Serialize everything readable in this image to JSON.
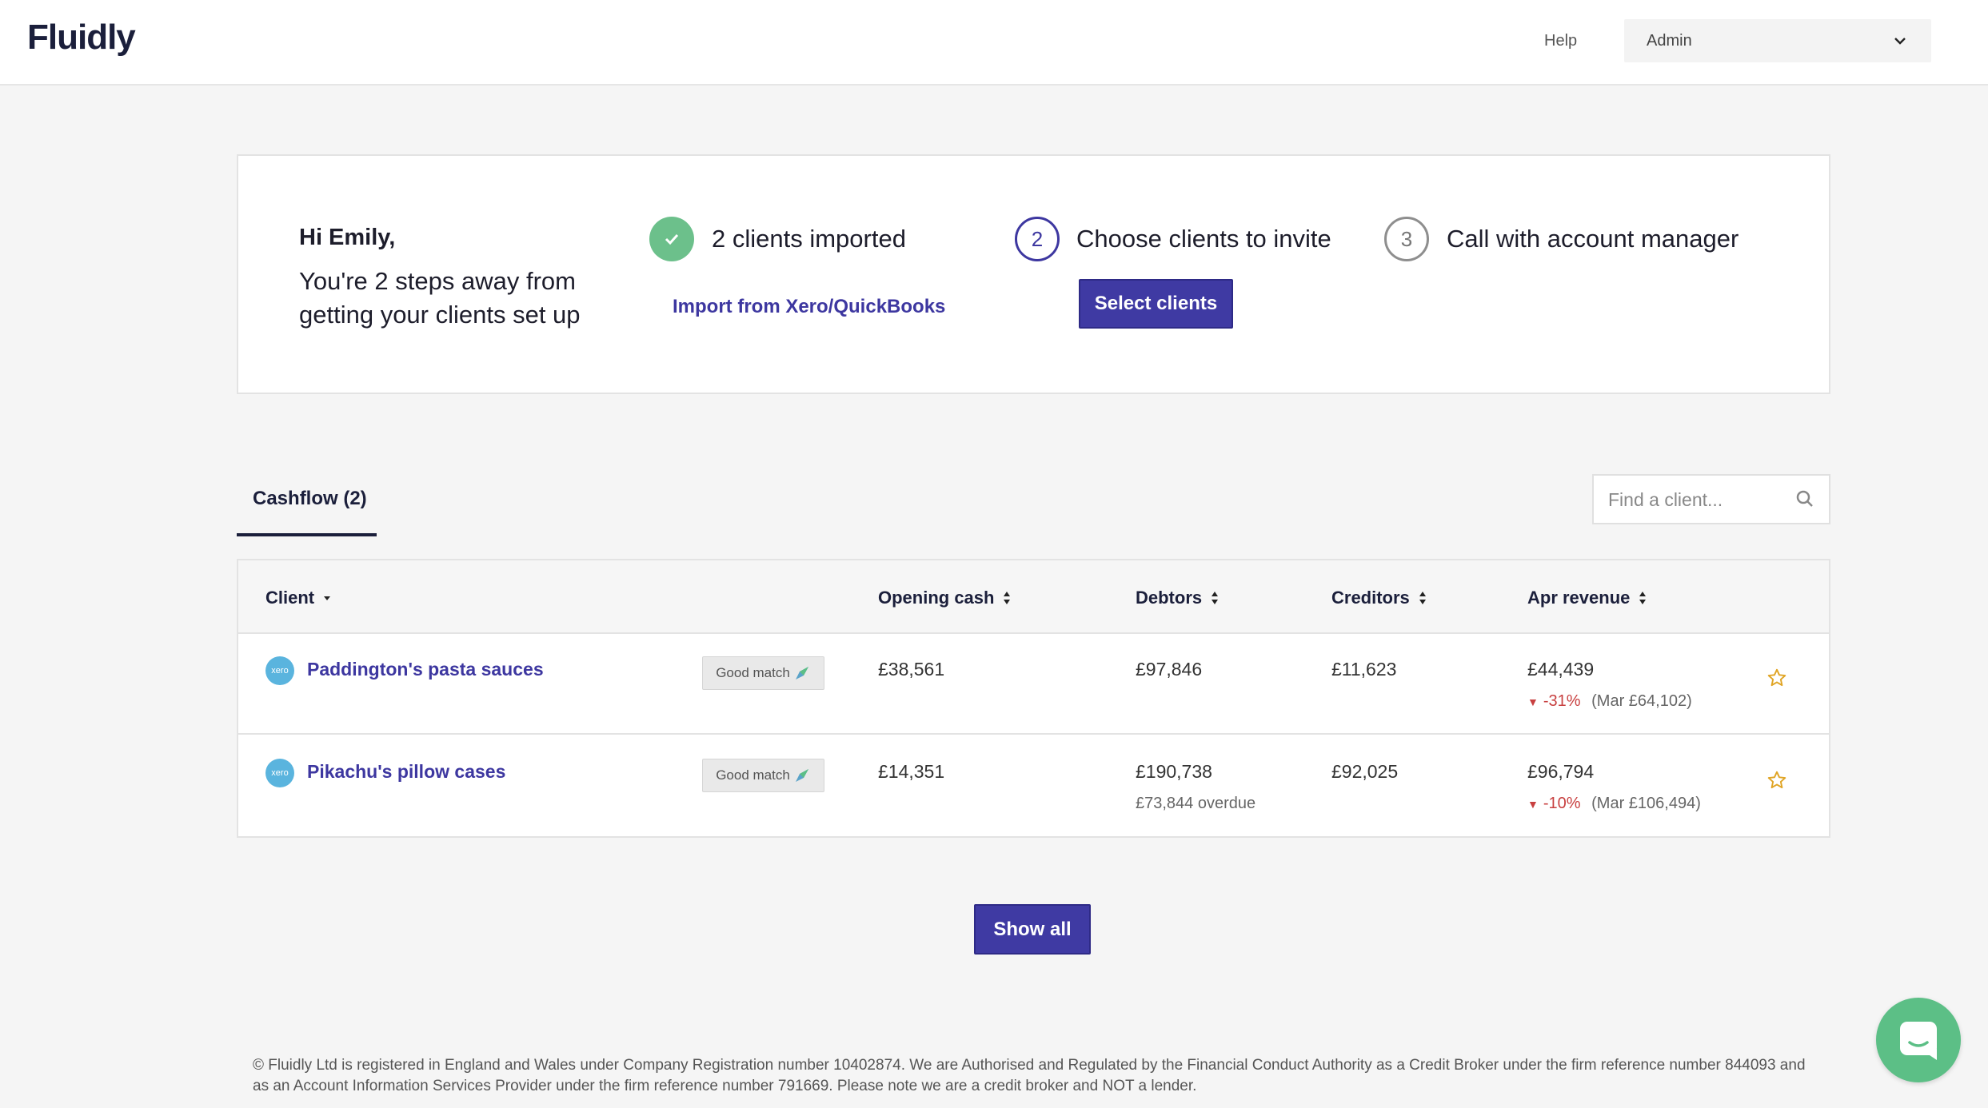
{
  "header": {
    "logo": "Fluidly",
    "help_label": "Help",
    "account_selected": "Admin"
  },
  "onboarding": {
    "greeting": "Hi Emily,",
    "subtitle": "You're 2 steps away from getting your clients set up",
    "steps": [
      {
        "number": "",
        "status": "done",
        "icon": "check-icon",
        "label": "2 clients imported",
        "action": "Import from Xero/QuickBooks"
      },
      {
        "number": "2",
        "status": "active",
        "label": "Choose clients to invite",
        "action": "Select clients"
      },
      {
        "number": "3",
        "status": "pending",
        "label": "Call with account manager"
      }
    ]
  },
  "tabs": [
    {
      "label": "Cashflow (2)",
      "active": true
    }
  ],
  "search": {
    "placeholder": "Find a client..."
  },
  "table": {
    "headers": {
      "client": "Client",
      "opening_cash": "Opening cash",
      "debtors": "Debtors",
      "creditors": "Creditors",
      "revenue": "Apr revenue"
    },
    "rows": [
      {
        "source_icon": "xero",
        "client": "Paddington's pasta sauces",
        "match": "Good match",
        "opening_cash": "£38,561",
        "debtors": "£97,846",
        "debtors_note": "",
        "creditors": "£11,623",
        "revenue": "£44,439",
        "revenue_change": "-31%",
        "revenue_prev": "(Mar £64,102)",
        "starred": false
      },
      {
        "source_icon": "xero",
        "client": "Pikachu's pillow cases",
        "match": "Good match",
        "opening_cash": "£14,351",
        "debtors": "£190,738",
        "debtors_note": "£73,844 overdue",
        "creditors": "£92,025",
        "revenue": "£96,794",
        "revenue_change": "-10%",
        "revenue_prev": "(Mar £106,494)",
        "starred": false
      }
    ]
  },
  "show_all_label": "Show all",
  "footer_text": "© Fluidly Ltd is registered in England and Wales under Company Registration number 10402874. We are Authorised and Regulated by the Financial Conduct Authority as a Credit Broker under the firm reference number 844093 and as an Account Information Services Provider under the firm reference number 791669. Please note we are a credit broker and NOT a lender.",
  "colors": {
    "brand": "#3f3aa3",
    "success": "#6cc08b",
    "negative": "#c84040",
    "star": "#e0a526",
    "chat": "#5cbf86"
  }
}
